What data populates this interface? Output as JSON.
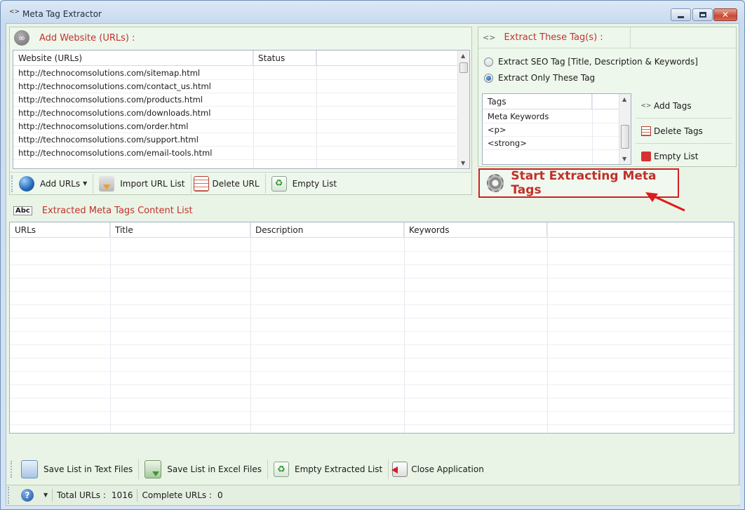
{
  "window": {
    "title": "Meta Tag Extractor",
    "close_glyph": "✕"
  },
  "add_website": {
    "title": "Add Website (URLs) :",
    "columns": [
      "Website (URLs)",
      "Status"
    ],
    "rows": [
      "http://technocomsolutions.com/sitemap.html",
      "http://technocomsolutions.com/contact_us.html",
      "http://technocomsolutions.com/products.html",
      "http://technocomsolutions.com/downloads.html",
      "http://technocomsolutions.com/order.html",
      "http://technocomsolutions.com/support.html",
      "http://technocomsolutions.com/email-tools.html"
    ],
    "toolbar": {
      "add_urls": "Add URLs",
      "import_url_list": "Import URL List",
      "delete_url": "Delete URL",
      "empty_list": "Empty List"
    }
  },
  "extract_tags": {
    "title": "Extract These Tag(s) :",
    "option_seo": "Extract SEO Tag [Title, Description & Keywords]",
    "option_only": "Extract Only These Tag",
    "selected_option": "option_only",
    "tags_header": "Tags",
    "tags": [
      "Meta Keywords",
      "<p>",
      "<strong>"
    ],
    "add_tags": "Add Tags",
    "delete_tags": "Delete Tags",
    "empty_list": "Empty List",
    "add_tags_glyph": "<>"
  },
  "start_button": {
    "label": "Start Extracting Meta Tags"
  },
  "extracted": {
    "title": "Extracted Meta Tags Content List",
    "icon_text": "Abc",
    "columns": [
      "URLs",
      "Title",
      "Description",
      "Keywords"
    ]
  },
  "bottom_toolbar": {
    "save_text": "Save List in Text Files",
    "save_excel": "Save List in Excel Files",
    "empty_extracted": "Empty Extracted List",
    "close_app": "Close Application"
  },
  "status": {
    "help_glyph": "?",
    "total_urls_label": "Total URLs :",
    "total_urls_value": "1016",
    "complete_urls_label": "Complete URLs :",
    "complete_urls_value": "0"
  },
  "colors": {
    "accent_red": "#c0302a",
    "panel_bg": "#eef7ec",
    "highlight_border": "#d21f1f"
  }
}
